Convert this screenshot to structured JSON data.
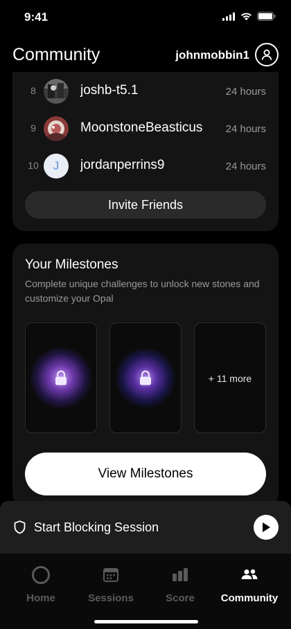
{
  "status": {
    "time": "9:41"
  },
  "header": {
    "title": "Community",
    "username": "johnmobbin1"
  },
  "leaderboard": {
    "rows": [
      {
        "rank": "8",
        "name": "joshb-t5.1",
        "time": "24 hours"
      },
      {
        "rank": "9",
        "name": "MoonstoneBeasticus",
        "time": "24 hours"
      },
      {
        "rank": "10",
        "name": "jordanperrins9",
        "time": "24 hours",
        "initial": "J"
      }
    ],
    "invite_label": "Invite Friends"
  },
  "milestones": {
    "title": "Your Milestones",
    "description": "Complete unique challenges to unlock new stones and customize your Opal",
    "more_label": "+ 11 more",
    "view_label": "View Milestones"
  },
  "blocking": {
    "label": "Start Blocking Session"
  },
  "tabs": [
    {
      "label": "Home",
      "icon": "home-ring-icon"
    },
    {
      "label": "Sessions",
      "icon": "calendar-icon"
    },
    {
      "label": "Score",
      "icon": "bar-chart-icon"
    },
    {
      "label": "Community",
      "icon": "people-icon",
      "active": true
    }
  ],
  "colors": {
    "background": "#000000",
    "card": "#141414",
    "accent_glow": "#8c46dc"
  }
}
